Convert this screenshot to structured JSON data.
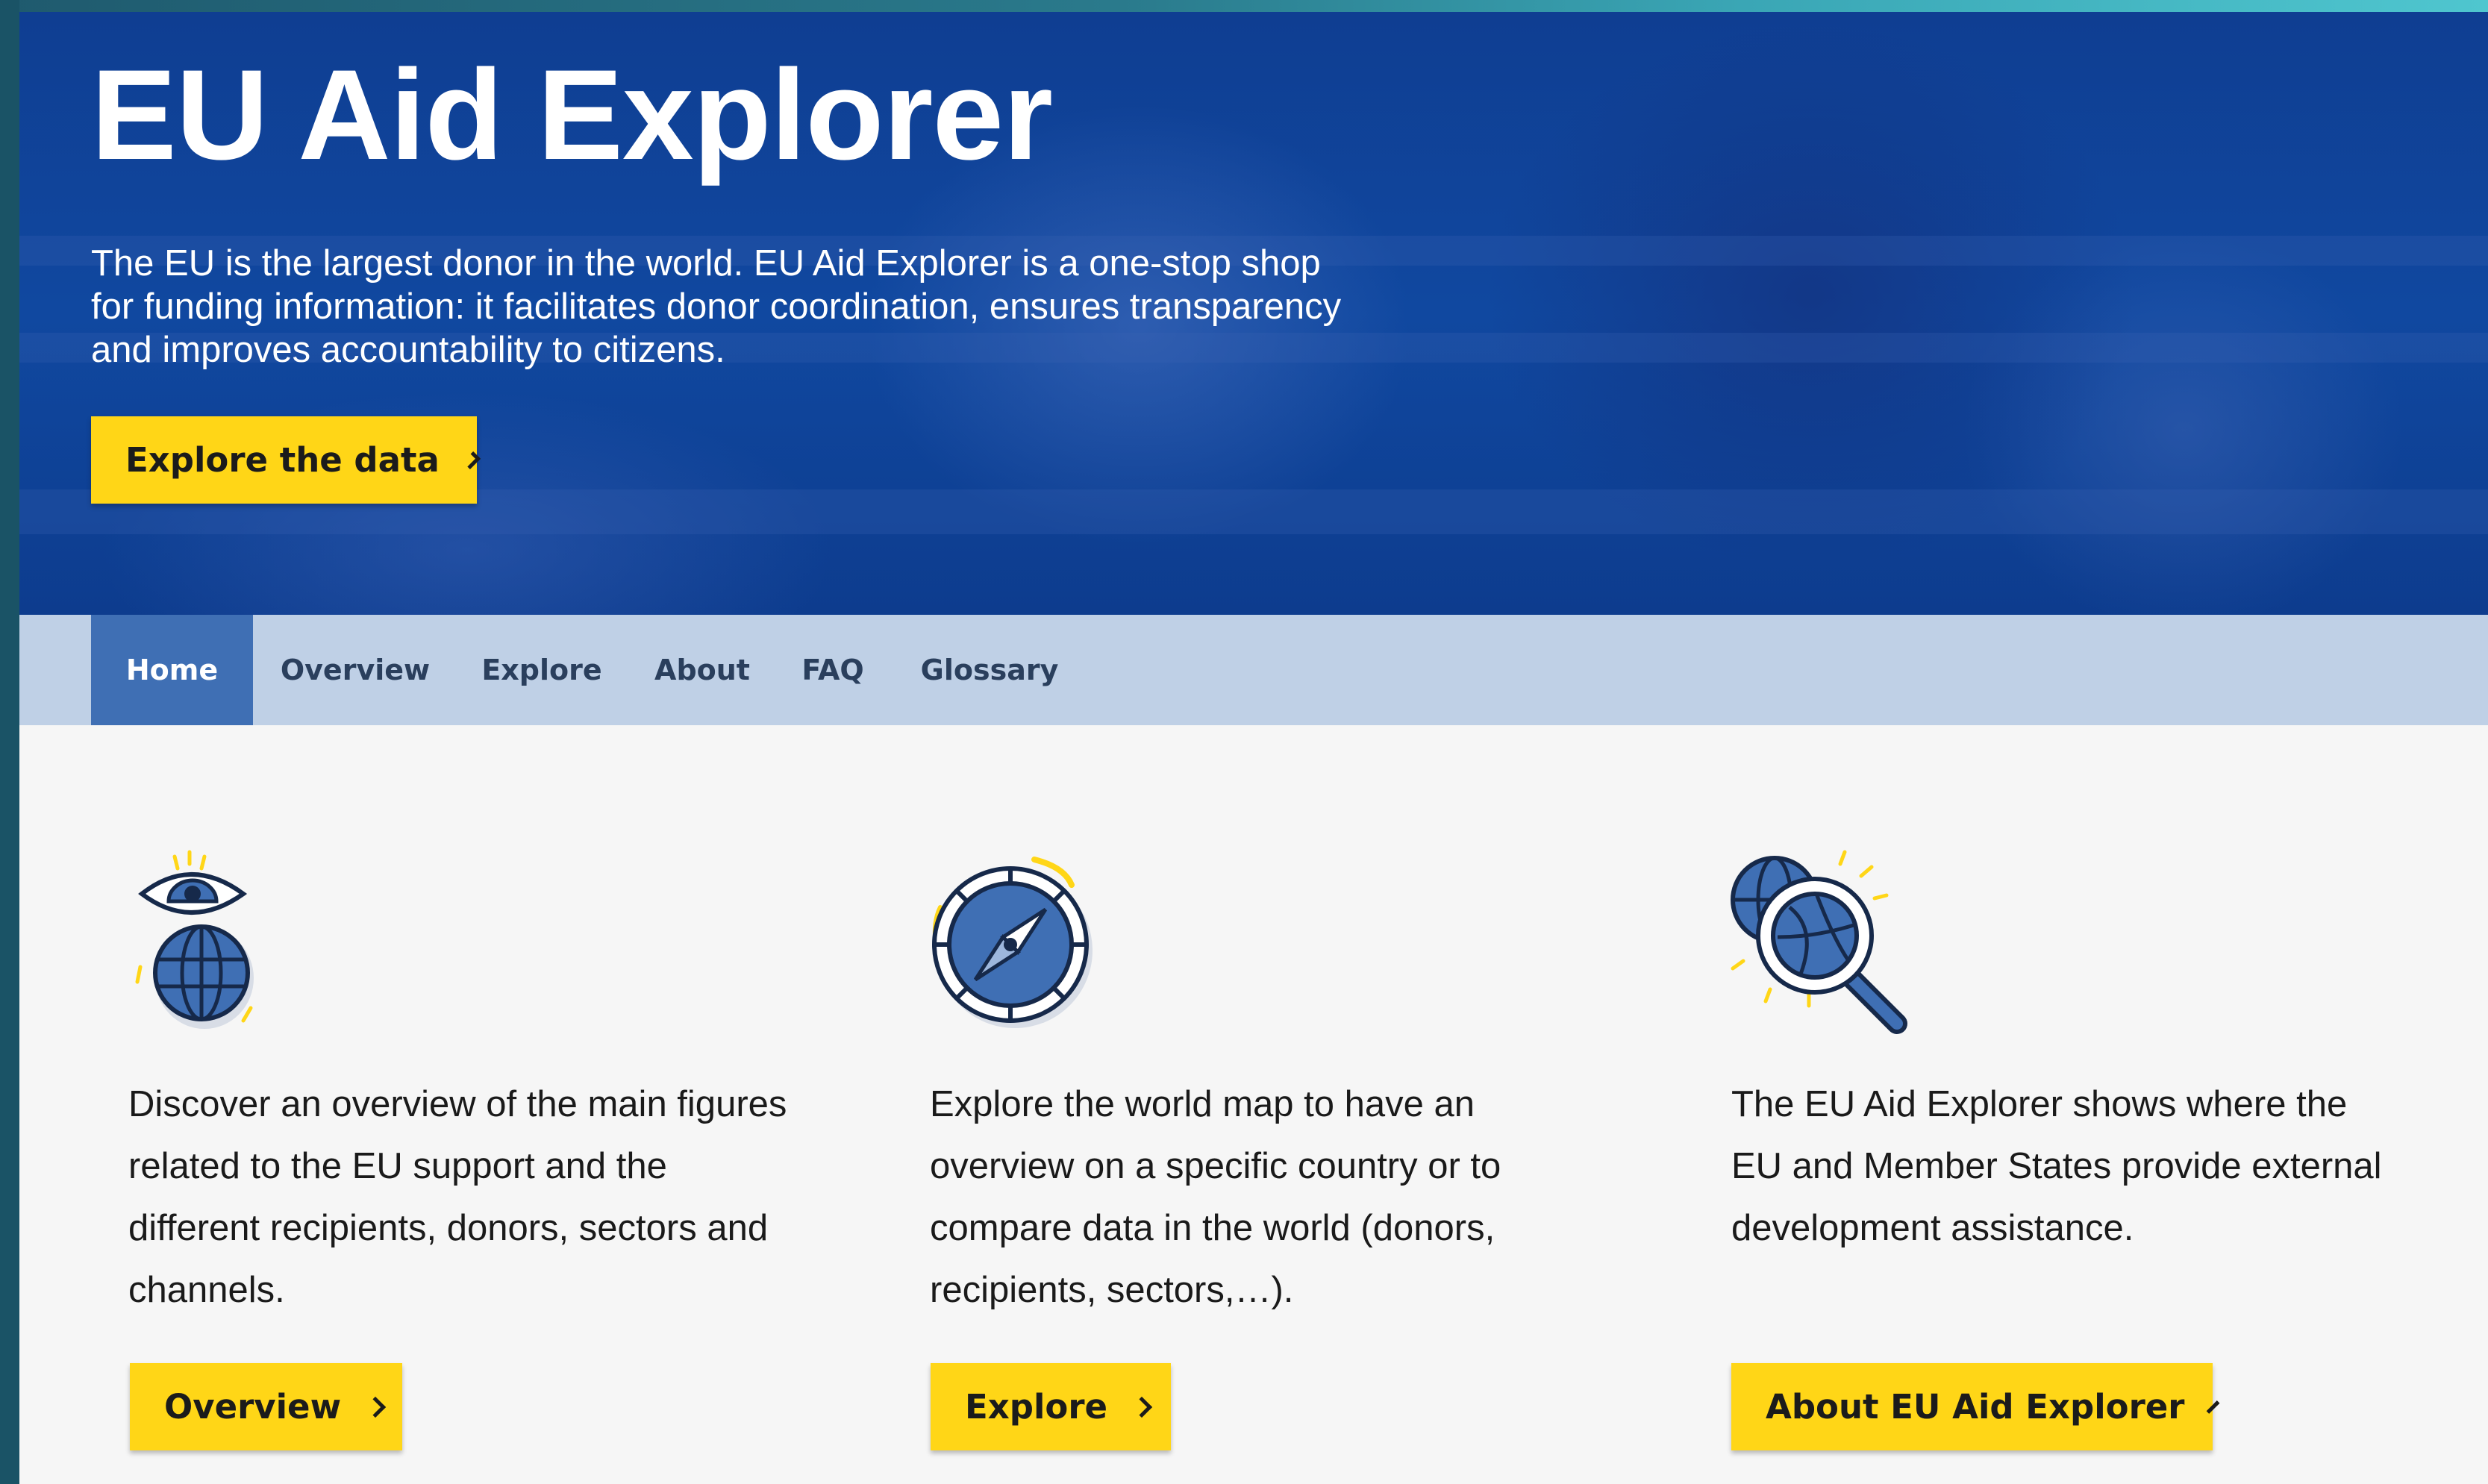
{
  "hero": {
    "title": "EU Aid Explorer",
    "description": "The EU is the largest donor in the world. EU Aid Explorer is a one-stop shop for funding information: it facilitates donor coordination, ensures transparency and improves accountability to citizens.",
    "cta_label": "Explore the data"
  },
  "nav": {
    "items": [
      {
        "label": "Home",
        "active": true
      },
      {
        "label": "Overview",
        "active": false
      },
      {
        "label": "Explore",
        "active": false
      },
      {
        "label": "About",
        "active": false
      },
      {
        "label": "FAQ",
        "active": false
      },
      {
        "label": "Glossary",
        "active": false
      }
    ]
  },
  "cards": [
    {
      "icon": "eye-globe-icon",
      "text": "Discover an overview of the main figures related to the EU support and the different recipients, donors, sectors and channels.",
      "button_label": "Overview"
    },
    {
      "icon": "compass-icon",
      "text": "Explore the world map to have an overview on a specific country or to compare data in the world (donors, recipients, sectors,…).",
      "button_label": "Explore"
    },
    {
      "icon": "globe-magnifier-icon",
      "text": "The EU Aid Explorer shows where the EU and Member States provide external development assistance.",
      "button_label": "About EU Aid Explorer"
    }
  ],
  "colors": {
    "hero_blue": "#1048a0",
    "accent_yellow": "#ffd617",
    "nav_background": "#bfd0e6",
    "nav_active": "#3f6fb4",
    "page_background": "#f6f6f6"
  }
}
